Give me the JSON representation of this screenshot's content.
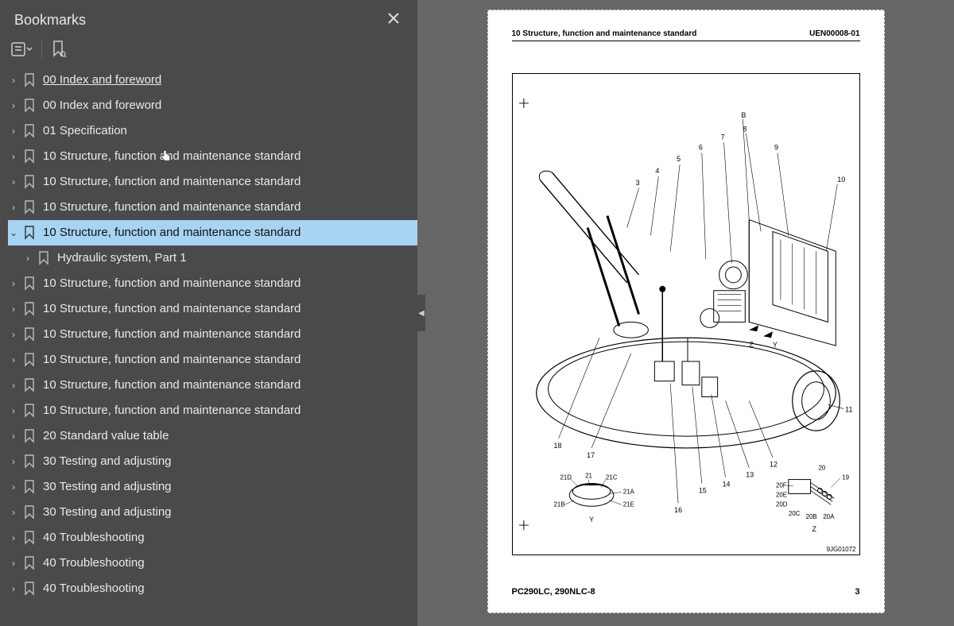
{
  "sidebar": {
    "title": "Bookmarks",
    "items": [
      {
        "label": "00 Index and foreword",
        "level": 0,
        "expandIcon": "right",
        "underline": true
      },
      {
        "label": "00 Index and foreword",
        "level": 0,
        "expandIcon": "right"
      },
      {
        "label": "01 Specification",
        "level": 0,
        "expandIcon": "right"
      },
      {
        "label": "10 Structure, function and maintenance standard",
        "level": 0,
        "expandIcon": "right"
      },
      {
        "label": "10 Structure, function and maintenance standard",
        "level": 0,
        "expandIcon": "right"
      },
      {
        "label": "10 Structure, function and maintenance standard",
        "level": 0,
        "expandIcon": "right"
      },
      {
        "label": "10 Structure, function and maintenance standard",
        "level": 0,
        "expandIcon": "down",
        "selected": true
      },
      {
        "label": "Hydraulic system, Part 1",
        "level": 1,
        "expandIcon": "right"
      },
      {
        "label": "10 Structure, function and maintenance standard",
        "level": 0,
        "expandIcon": "right"
      },
      {
        "label": "10 Structure, function and maintenance standard",
        "level": 0,
        "expandIcon": "right"
      },
      {
        "label": "10 Structure, function and maintenance standard",
        "level": 0,
        "expandIcon": "right"
      },
      {
        "label": "10 Structure, function and maintenance standard",
        "level": 0,
        "expandIcon": "right"
      },
      {
        "label": "10 Structure, function and maintenance standard",
        "level": 0,
        "expandIcon": "right"
      },
      {
        "label": "10 Structure, function and maintenance standard",
        "level": 0,
        "expandIcon": "right"
      },
      {
        "label": "20 Standard value table",
        "level": 0,
        "expandIcon": "right"
      },
      {
        "label": "30 Testing and adjusting",
        "level": 0,
        "expandIcon": "right"
      },
      {
        "label": "30 Testing and adjusting",
        "level": 0,
        "expandIcon": "right"
      },
      {
        "label": "30 Testing and adjusting",
        "level": 0,
        "expandIcon": "right"
      },
      {
        "label": "40 Troubleshooting",
        "level": 0,
        "expandIcon": "right"
      },
      {
        "label": "40 Troubleshooting",
        "level": 0,
        "expandIcon": "right"
      },
      {
        "label": "40 Troubleshooting",
        "level": 0,
        "expandIcon": "right"
      }
    ]
  },
  "document": {
    "header_left": "10 Structure, function and maintenance standard",
    "header_right": "UEN00008-01",
    "figure_code": "9JG01072",
    "callouts_top": [
      "3",
      "4",
      "5",
      "6",
      "7",
      "8",
      "9",
      "10",
      "B"
    ],
    "callouts_side": [
      "11",
      "12",
      "13",
      "14",
      "15",
      "16",
      "17",
      "18"
    ],
    "callouts_detail_left": [
      "21",
      "21A",
      "21B",
      "21C",
      "21D",
      "21E",
      "Y"
    ],
    "callouts_detail_right": [
      "19",
      "20",
      "20A",
      "20B",
      "20C",
      "20D",
      "20E",
      "20F",
      "Z"
    ],
    "inner_labels": [
      "Y",
      "Z"
    ],
    "footer_left": "PC290LC, 290NLC-8",
    "footer_right": "3"
  }
}
